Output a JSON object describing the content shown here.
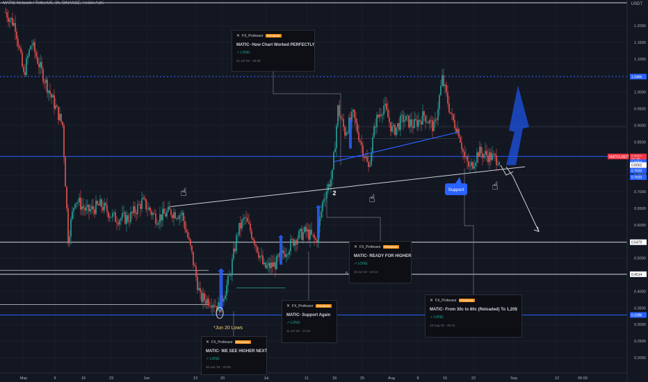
{
  "header": {
    "symbol_line": "MATIC Network / TetherUS, 3h, BINANCE, Heikin Ashi"
  },
  "price_axis": {
    "currency": "USDT",
    "ticks": [
      "1.2000",
      "1.1500",
      "1.1000",
      "1.0500",
      "1.0000",
      "0.9500",
      "0.9000",
      "0.8500",
      "0.8000",
      "0.7500",
      "0.7000",
      "0.6500",
      "0.6000",
      "0.5500",
      "0.5000",
      "0.4500",
      "0.4000",
      "0.3500",
      "0.3000",
      "0.2500",
      "0.2000"
    ],
    "tags": [
      {
        "text": "1.0466",
        "bg": "#2962ff",
        "fg": "#ffffff",
        "price": 1.0466
      },
      {
        "text": "MATICUSDT",
        "bg": "#f23645",
        "fg": "#ffffff",
        "price": 0.8061
      },
      {
        "text": "0.8061",
        "bg": "#f23645",
        "fg": "#ffffff",
        "price": 0.8061
      },
      {
        "text": "21:30",
        "bg": "#f23645",
        "fg": "#ffffff",
        "price": 0.7975
      },
      {
        "text": "0.8054",
        "bg": "#2962ff",
        "fg": "#ffffff",
        "price": 0.7888
      },
      {
        "text": "0.8002",
        "bg": "#ffffff",
        "fg": "#131722",
        "price": 0.7801
      },
      {
        "text": "0.7633",
        "bg": "#2962ff",
        "fg": "#ffffff",
        "price": 0.7633
      },
      {
        "text": "0.7633",
        "bg": "#2962ff",
        "fg": "#ffffff",
        "price": 0.7438
      },
      {
        "text": "0.5479",
        "bg": "#ffffff",
        "fg": "#131722",
        "price": 0.5479
      },
      {
        "text": "0.4514",
        "bg": "#ffffff",
        "fg": "#131722",
        "price": 0.4514
      },
      {
        "text": "0.3286",
        "bg": "#2962ff",
        "fg": "#ffffff",
        "price": 0.3286
      }
    ]
  },
  "time_axis": {
    "labels": [
      "May",
      "9",
      "16",
      "23",
      "Jun",
      "13",
      "20",
      "Jul",
      "11",
      "18",
      "25",
      "Aug",
      "8",
      "15",
      "22",
      "Sep",
      "12",
      "06:00"
    ]
  },
  "annotations": {
    "jun20_lows": "*Jun 20 Lows",
    "wave_label": "2",
    "small_label": "0.",
    "support_label": "Support"
  },
  "ideas": [
    {
      "author": "FX_Professor",
      "badge": "PREMIUM",
      "title": "MATIC- How Chart Worked PERFECTLY",
      "direction": "↗ LONG",
      "date": "21 Jul '22 - 19:29"
    },
    {
      "author": "FX_Professor",
      "badge": "PREMIUM",
      "title": "MATIC- READY FOR HIGHER",
      "direction": "↗ LONG",
      "date": "15 Jul '22 - 22:14"
    },
    {
      "author": "FX_Professor",
      "badge": "PREMIUM",
      "title": "MATIC- Support Again",
      "direction": "↗ LONG",
      "date": "11 Jul '22 - 17:24"
    },
    {
      "author": "FX_Professor",
      "badge": "PREMIUM",
      "title": "MATIC- From 30c to 80c (Reloaded) To 1,20$",
      "direction": "↗ LONG",
      "date": "19 Aug '22 - 20:41"
    },
    {
      "author": "FX_Professor",
      "badge": "PREMIUM",
      "title": "MATIC- WE SEE HIGHER NEXT",
      "direction": "↗ LONG",
      "date": "20 Jun '22 - 20:02"
    }
  ],
  "chart_data": {
    "type": "line",
    "title": "MATIC Network / TetherUS, 3h, BINANCE, Heikin Ashi",
    "xlabel": "",
    "ylabel": "USDT",
    "ylim": [
      0.2,
      1.25
    ],
    "x": [
      "May",
      "9",
      "16",
      "23",
      "Jun",
      "13",
      "20",
      "Jul",
      "11",
      "18",
      "25",
      "Aug",
      "8",
      "15",
      "22",
      "Sep"
    ],
    "series": [
      {
        "values": [
          1.25,
          0.92,
          0.62,
          0.63,
          0.64,
          0.56,
          0.34,
          0.45,
          0.55,
          0.93,
          0.76,
          0.95,
          0.92,
          1.04,
          0.8,
          0.81
        ]
      }
    ],
    "horizontal_levels": [
      1.0466,
      0.8061,
      0.5479,
      0.4514,
      0.3286
    ],
    "colors": {
      "up": "#26a69a",
      "down": "#ef5350",
      "level": "#2962ff",
      "background": "#131722"
    }
  }
}
